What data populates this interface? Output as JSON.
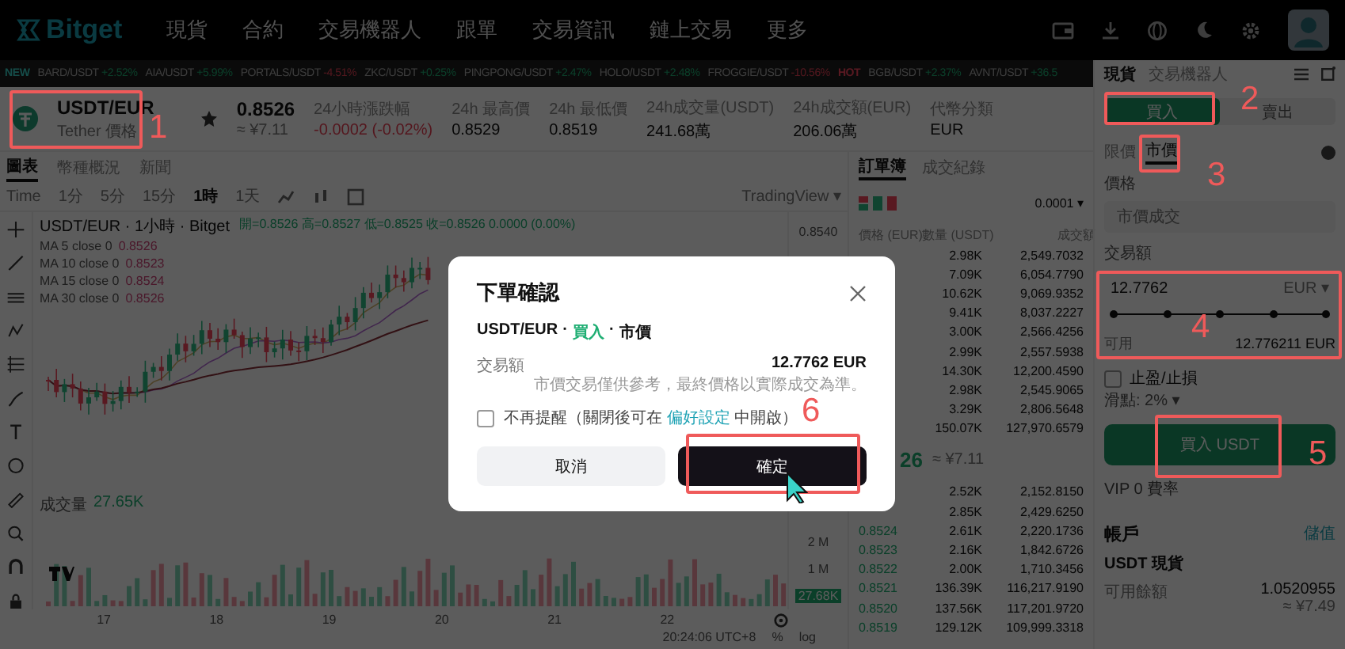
{
  "nav": {
    "logo": "Bitget",
    "items": [
      "現貨",
      "合約",
      "交易機器人",
      "跟單",
      "交易資訊",
      "鏈上交易",
      "更多"
    ]
  },
  "ticker": {
    "badge": "NEW",
    "items": [
      {
        "pair": "BARD/USDT",
        "change": "+2.52%",
        "kind": "gain"
      },
      {
        "pair": "AIA/USDT",
        "change": "+5.99%",
        "kind": "gain"
      },
      {
        "pair": "PORTALS/USDT",
        "change": "-4.51%",
        "kind": "loss"
      },
      {
        "pair": "ZKC/USDT",
        "change": "+0.25%",
        "kind": "gain"
      },
      {
        "pair": "PINGPONG/USDT",
        "change": "+2.47%",
        "kind": "gain"
      },
      {
        "pair": "HOLO/USDT",
        "change": "+2.48%",
        "kind": "gain"
      },
      {
        "pair": "FROGGIE/USDT",
        "change": "-10.56%",
        "kind": "loss"
      },
      {
        "pair": "HOT",
        "kind": "tag"
      },
      {
        "pair": "BGB/USDT",
        "change": "+2.37%",
        "kind": "gain"
      },
      {
        "pair": "AVNT/USDT",
        "change": "+36.5",
        "kind": "gain"
      }
    ]
  },
  "market": {
    "pair": "USDT/EUR",
    "name": "Tether 價格",
    "price": "0.8526",
    "price_sub": "≈ ¥7.11",
    "stats": [
      {
        "label": "24小時漲跌幅",
        "value": "-0.0002 (-0.02%)",
        "kind": "loss"
      },
      {
        "label": "24h 最高價",
        "value": "0.8529",
        "kind": "plain"
      },
      {
        "label": "24h 最低價",
        "value": "0.8519",
        "kind": "plain"
      },
      {
        "label": "24h成交量(USDT)",
        "value": "241.68萬",
        "kind": "plain"
      },
      {
        "label": "24h成交額(EUR)",
        "value": "206.06萬",
        "kind": "plain"
      },
      {
        "label": "代幣分類",
        "value": "EUR",
        "kind": "plain"
      }
    ]
  },
  "chart_tabs": [
    {
      "label": "圖表",
      "selected": true
    },
    {
      "label": "幣種概況",
      "selected": false
    },
    {
      "label": "新聞",
      "selected": false
    }
  ],
  "intervals": [
    {
      "label": "Time",
      "selected": false
    },
    {
      "label": "1分",
      "selected": false
    },
    {
      "label": "5分",
      "selected": false
    },
    {
      "label": "15分",
      "selected": false
    },
    {
      "label": "1時",
      "selected": true
    },
    {
      "label": "1天",
      "selected": false
    }
  ],
  "chart_source": "TradingView ▾",
  "chart": {
    "title": "USDT/EUR · 1小時 · Bitget",
    "ohlc": "開=0.8526 高=0.8527 低=0.8525 收=0.8526 0.0000 (0.00%)",
    "ma": [
      {
        "label": "MA 5 close 0",
        "value": "0.8526"
      },
      {
        "label": "MA 10 close 0",
        "value": "0.8523"
      },
      {
        "label": "MA 15 close 0",
        "value": "0.8524"
      },
      {
        "label": "MA 30 close 0",
        "value": "0.8526"
      }
    ],
    "volume_label": "成交量",
    "volume_value": "27.65K",
    "price_tick": "0.8540",
    "volume_ticks": [
      "2 M",
      "1 M"
    ],
    "volume_tag": "27.68K",
    "x_labels": [
      "17",
      "18",
      "19",
      "20",
      "21",
      "22"
    ],
    "time": "20:24:06 UTC+8",
    "percent": "%",
    "log": "log"
  },
  "orderbook": {
    "tabs": [
      {
        "label": "訂單簿",
        "selected": true
      },
      {
        "label": "成交紀錄",
        "selected": false
      }
    ],
    "precision": "0.0001 ▾",
    "headers": [
      "價格 (EUR)",
      "數量 (USDT)",
      "成交額"
    ],
    "asks": [
      {
        "qty": "2.98K",
        "total": "2,549.7032"
      },
      {
        "qty": "7.09K",
        "total": "6,054.7790"
      },
      {
        "qty": "10.62K",
        "total": "9,069.9352"
      },
      {
        "qty": "9.41K",
        "total": "8,037.2227"
      },
      {
        "qty": "3.00K",
        "total": "2,566.4256"
      },
      {
        "qty": "2.99K",
        "total": "2,557.5938"
      },
      {
        "qty": "14.30K",
        "total": "12,200.4590"
      },
      {
        "qty": "2.98K",
        "total": "2,545.9065"
      },
      {
        "qty": "3.29K",
        "total": "2,806.5648"
      },
      {
        "qty": "150.07K",
        "total": "127,970.6579"
      }
    ],
    "mid": "26",
    "mid_sub": "≈ ¥7.11",
    "bids": [
      {
        "qty": "2.52K",
        "total": "2,152.8150"
      },
      {
        "qty": "2.85K",
        "total": "2,429.6250"
      },
      {
        "price": "0.8524",
        "qty": "2.61K",
        "total": "2,220.1736"
      },
      {
        "price": "0.8523",
        "qty": "2.16K",
        "total": "1,842.6726"
      },
      {
        "price": "0.8522",
        "qty": "2.00K",
        "total": "1,710.3456"
      },
      {
        "price": "0.8521",
        "qty": "136.39K",
        "total": "116,217.9190"
      },
      {
        "price": "0.8520",
        "qty": "137.56K",
        "total": "117,201.9720"
      },
      {
        "price": "0.8519",
        "qty": "129.12K",
        "total": "109,999.3318"
      }
    ]
  },
  "trade": {
    "tabs": [
      {
        "label": "現貨",
        "selected": true
      },
      {
        "label": "交易機器人",
        "selected": false
      }
    ],
    "sides": [
      {
        "label": "買入",
        "selected": true
      },
      {
        "label": "賣出",
        "selected": false
      }
    ],
    "order_types": [
      {
        "label": "限價",
        "selected": false
      },
      {
        "label": "市價",
        "selected": true
      }
    ],
    "price_label": "價格",
    "price_placeholder": "市價成交",
    "amount_label": "交易額",
    "amount_value": "12.7762",
    "amount_unit": "EUR ▾",
    "slider": {
      "level": 1
    },
    "available_label": "可用",
    "available_value": "12.776211 EUR",
    "tpsl": {
      "label": "止盈/止損",
      "checked": false
    },
    "slippage": "滑點: 2% ▾",
    "submit": "買入 USDT",
    "vip": "VIP 0 費率",
    "account_title": "帳戶",
    "deposit": "儲值",
    "asset_title": "USDT 現貨",
    "balance_label": "可用餘額",
    "balance_value": "1.0520955",
    "balance_sub": "≈ ¥7.49"
  },
  "dialog": {
    "title": "下單確認",
    "order_line": [
      {
        "text": "USDT/EUR",
        "kind": "plain"
      },
      {
        "text": "·",
        "kind": "plain"
      },
      {
        "text": "買入",
        "kind": "buy"
      },
      {
        "text": "·",
        "kind": "plain"
      },
      {
        "text": "市價",
        "kind": "plain"
      }
    ],
    "amount_label": "交易額",
    "amount_value": "12.7762 EUR",
    "note": "市價交易僅供參考，最終價格以實際成交為準。",
    "remind": {
      "checked": false,
      "before": "不再提醒（關閉後可在",
      "link": "偏好設定",
      "after": "中開啟）"
    },
    "cancel": "取消",
    "confirm": "確定"
  },
  "annotations": [
    {
      "label": "1"
    },
    {
      "label": "2"
    },
    {
      "label": "3"
    },
    {
      "label": "4"
    },
    {
      "label": "5"
    },
    {
      "label": "6"
    }
  ]
}
